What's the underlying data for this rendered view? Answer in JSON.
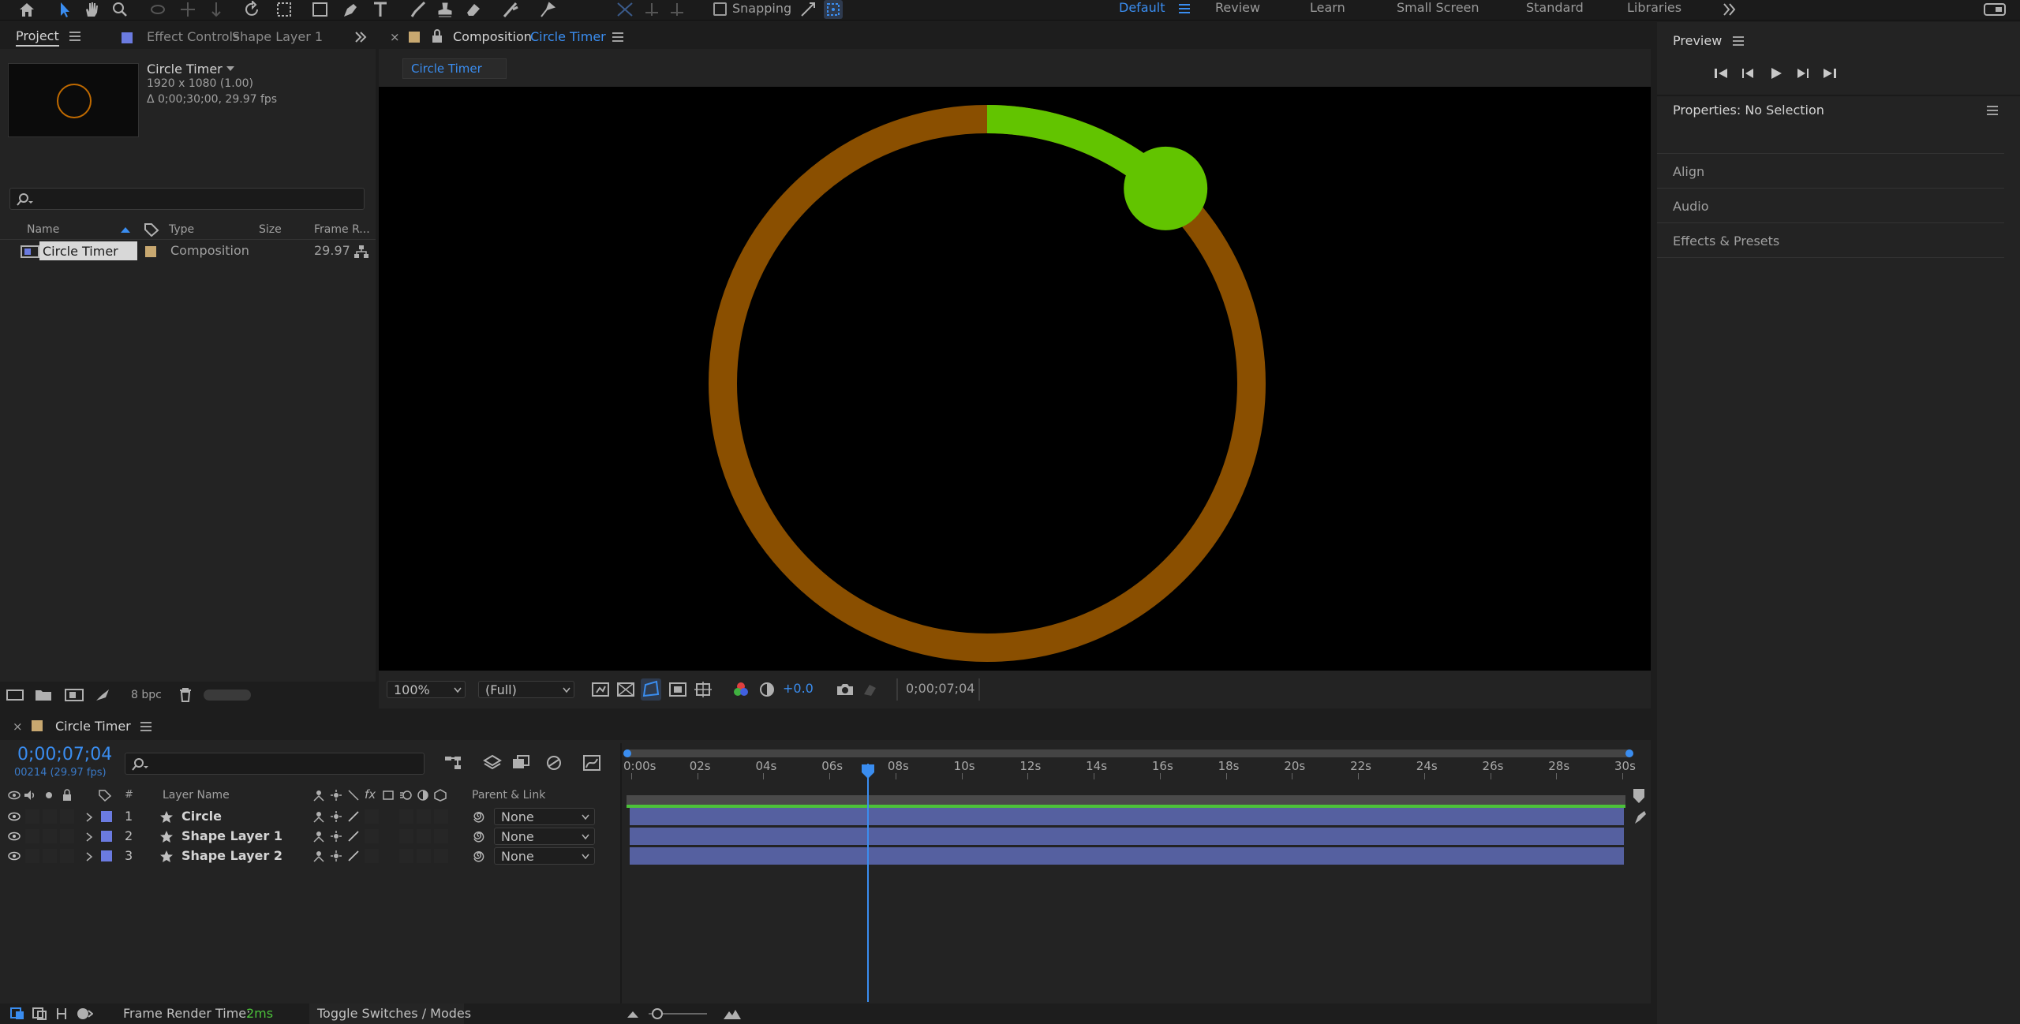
{
  "toolbar": {
    "snapping_label": "Snapping",
    "workspaces": [
      "Default",
      "Review",
      "Learn",
      "Small Screen",
      "Standard",
      "Libraries"
    ],
    "active_workspace": "Default"
  },
  "project": {
    "tab_label": "Project",
    "effect_controls_tab": "Effect Controls",
    "effect_controls_layer": "Shape Layer 1",
    "item_name": "Circle Timer",
    "item_dims": "1920 x 1080 (1.00)",
    "item_duration": "Δ 0;00;30;00, 29.97 fps",
    "columns": {
      "name": "Name",
      "type": "Type",
      "size": "Size",
      "frame_rate": "Frame R..."
    },
    "row": {
      "name": "Circle Timer",
      "type": "Composition",
      "frame_rate": "29.97"
    },
    "bpc": "8 bpc"
  },
  "composition": {
    "tab_prefix": "Composition",
    "tab_name": "Circle Timer",
    "breadcrumb": "Circle Timer",
    "zoom": "100%",
    "resolution": "(Full)",
    "exposure": "+0.0",
    "timecode": "0;00;07;04",
    "progress_fraction": 0.118
  },
  "preview": {
    "title": "Preview",
    "properties_title": "Properties: No Selection",
    "sections": [
      "Align",
      "Audio",
      "Effects & Presets"
    ]
  },
  "timeline": {
    "tab_name": "Circle Timer",
    "timecode": "0;00;07;04",
    "frames": "00214 (29.97 fps)",
    "col_layer_name": "Layer Name",
    "col_num": "#",
    "col_parent": "Parent & Link",
    "layers": [
      {
        "num": "1",
        "name": "Circle",
        "parent": "None"
      },
      {
        "num": "2",
        "name": "Shape Layer 1",
        "parent": "None"
      },
      {
        "num": "3",
        "name": "Shape Layer 2",
        "parent": "None"
      }
    ],
    "ruler": [
      "0:00s",
      "02s",
      "04s",
      "06s",
      "08s",
      "10s",
      "12s",
      "14s",
      "16s",
      "18s",
      "20s",
      "22s",
      "24s",
      "26s",
      "28s",
      "30s"
    ],
    "playhead_seconds": 7.13,
    "duration_seconds": 30
  },
  "status": {
    "render_label": "Frame Render Time:",
    "render_value": "2ms",
    "toggle_label": "Toggle Switches / Modes"
  },
  "colors": {
    "accent": "#3a8df0",
    "ring_track": "#8a4f00",
    "ring_progress": "#62c400",
    "layer_bar": "#5560a0",
    "layer_label": "#6b7be0"
  }
}
